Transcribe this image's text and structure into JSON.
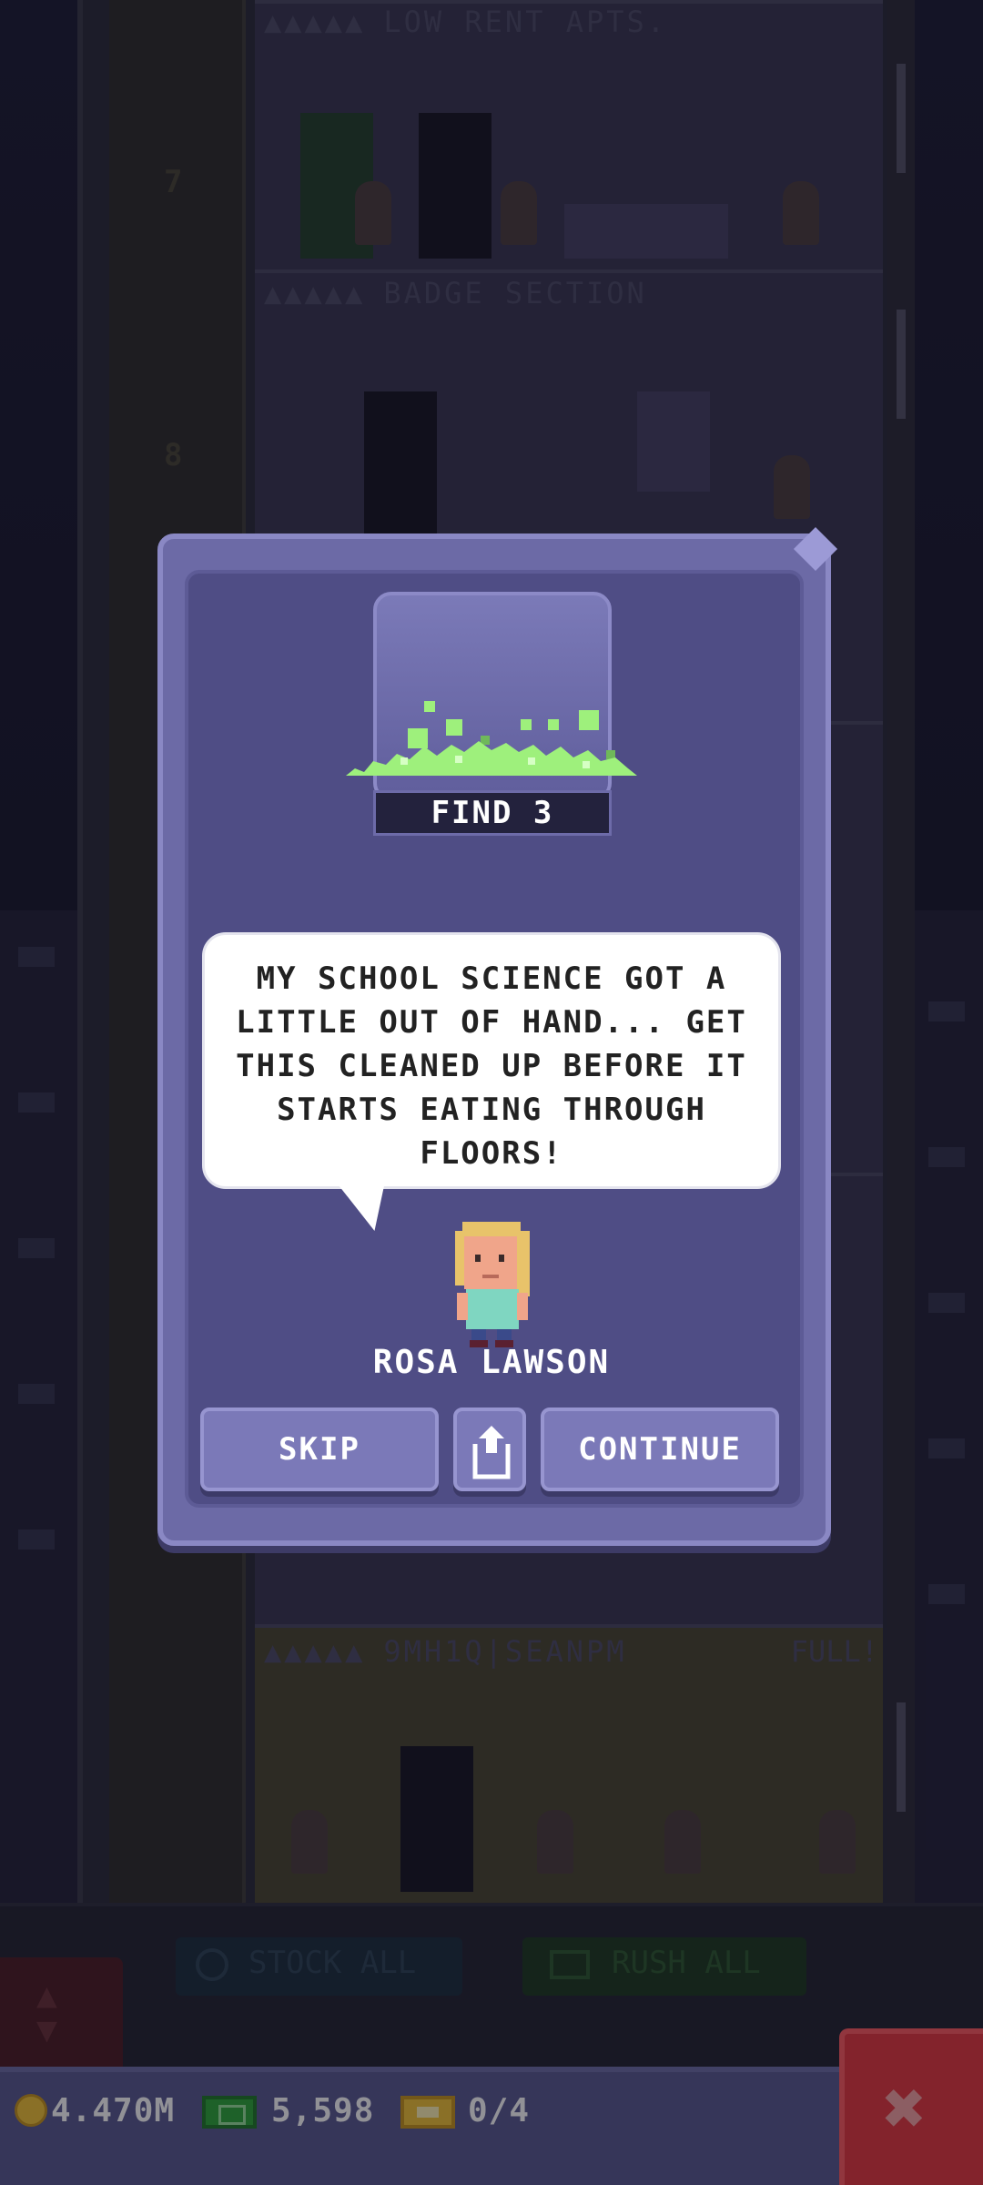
{
  "tower": {
    "floor_7": {
      "number": "7",
      "name": "LOW RENT APTS.",
      "stars": "▲▲▲▲▲"
    },
    "floor_badge": {
      "name": "BADGE SECTION",
      "stars": "▲▲▲▲▲"
    },
    "floor_8": {
      "number": "8"
    },
    "floor_bottom": {
      "name": "9MH1Q|SEANPM",
      "stars": "▲▲▲▲▲",
      "status": "FULL!"
    }
  },
  "bottom_bar": {
    "stock_all_label": "STOCK ALL",
    "rush_all_label": "RUSH ALL"
  },
  "currency": {
    "coins": "4.470M",
    "bux": "5,598",
    "tickets": "0/4"
  },
  "mission": {
    "goal_label": "FIND 3",
    "message": "MY SCHOOL SCIENCE GOT A LITTLE OUT OF HAND... GET THIS CLEANED UP BEFORE IT STARTS EATING THROUGH FLOORS!",
    "npc_name": "ROSA LAWSON",
    "skip_label": "SKIP",
    "continue_label": "CONTINUE"
  },
  "colors": {
    "dialog": "#6c6aa6",
    "dialog_inner": "#4f4d85",
    "goo": "#9ef07c",
    "close": "#e5373e"
  }
}
